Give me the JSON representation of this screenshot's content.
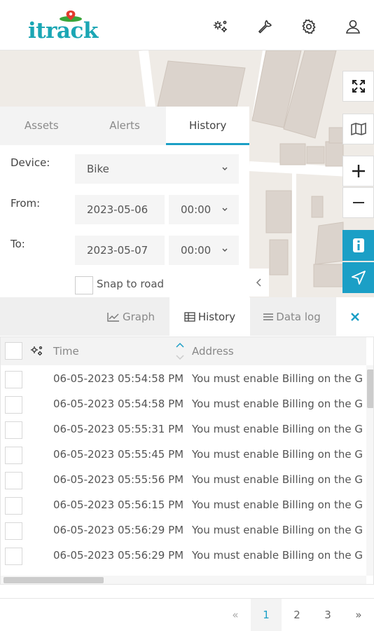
{
  "app": {
    "logo_text": "itrack"
  },
  "header": {
    "icons": [
      "settings-group-icon",
      "wrench-icon",
      "gear-icon",
      "user-icon"
    ]
  },
  "map": {
    "controls": [
      "fullscreen-icon",
      "map-layers-icon",
      "zoom-in-icon",
      "zoom-out-icon",
      "info-icon",
      "navigation-icon"
    ],
    "accent": "#1b9fc6"
  },
  "panel": {
    "tabs": [
      "Assets",
      "Alerts",
      "History"
    ],
    "active_tab": "History",
    "device_label": "Device:",
    "device_value": "Bike",
    "from_label": "From:",
    "from_date": "2023-05-06",
    "from_time": "00:00",
    "to_label": "To:",
    "to_date": "2023-05-07",
    "to_time": "00:00",
    "snap_label": "Snap to road"
  },
  "toolbar": {
    "graph_label": "Graph",
    "history_label": "History",
    "datalog_label": "Data log"
  },
  "table": {
    "columns": {
      "time": "Time",
      "address": "Address"
    },
    "rows": [
      {
        "time": "06-05-2023 05:54:58 PM",
        "address": "You must enable Billing on the Google Cloud Project"
      },
      {
        "time": "06-05-2023 05:54:58 PM",
        "address": "You must enable Billing on the Google Cloud Project"
      },
      {
        "time": "06-05-2023 05:55:31 PM",
        "address": "You must enable Billing on the Google Cloud Project"
      },
      {
        "time": "06-05-2023 05:55:45 PM",
        "address": "You must enable Billing on the Google Cloud Project"
      },
      {
        "time": "06-05-2023 05:55:56 PM",
        "address": "You must enable Billing on the Google Cloud Project"
      },
      {
        "time": "06-05-2023 05:56:15 PM",
        "address": "You must enable Billing on the Google Cloud Project"
      },
      {
        "time": "06-05-2023 05:56:29 PM",
        "address": "You must enable Billing on the Google Cloud Project"
      },
      {
        "time": "06-05-2023 05:56:29 PM",
        "address": "You must enable Billing on the Google Cloud Project"
      }
    ]
  },
  "pagination": {
    "prev": "«",
    "pages": [
      "1",
      "2",
      "3"
    ],
    "current": "1",
    "next": "»"
  }
}
